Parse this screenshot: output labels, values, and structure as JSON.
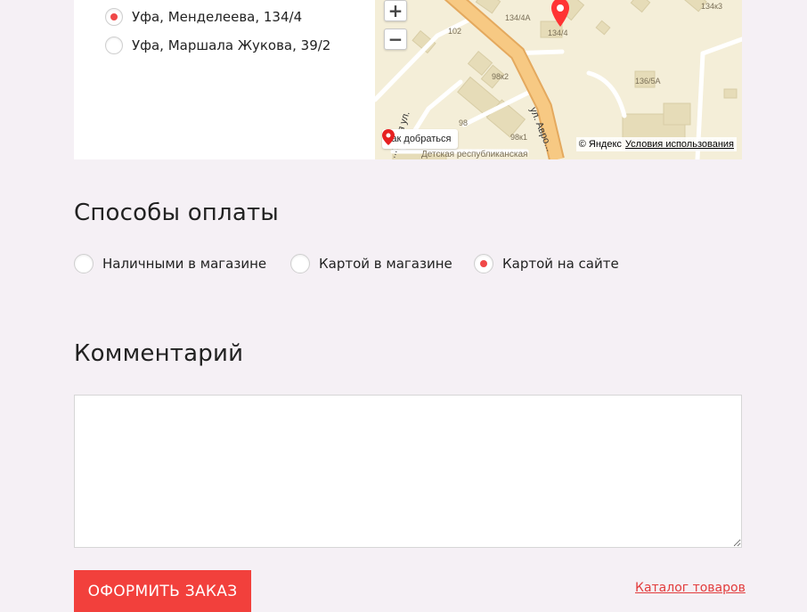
{
  "stores": {
    "options": [
      {
        "label": "Уфа, Менделеева, 134/4",
        "checked": true
      },
      {
        "label": "Уфа, Маршала Жукова, 39/2",
        "checked": false
      }
    ]
  },
  "map": {
    "zoom_in": "+",
    "zoom_out": "−",
    "route_label": "Как добраться",
    "copyright": "© Яндекс",
    "terms_link": "Условия использования",
    "labels": {
      "b102": "102",
      "b134_4a": "134/4A",
      "b134_4": "134/4",
      "b134k3": "134к3",
      "b98k2": "98к2",
      "b136_5a": "136/5А",
      "b98": "98",
      "b98k1": "98к1",
      "street_sovetskaya": "...тская ул.",
      "street_avrory": "ул. Авро...",
      "street_detskaya": "Детская республиканская"
    }
  },
  "payment": {
    "title": "Способы оплаты",
    "options": [
      {
        "label": "Наличными в магазине",
        "checked": false
      },
      {
        "label": "Картой в магазине",
        "checked": false
      },
      {
        "label": "Картой на сайте",
        "checked": true
      }
    ]
  },
  "comment": {
    "title": "Комментарий",
    "value": ""
  },
  "actions": {
    "submit_label": "ОФОРМИТЬ ЗАКАЗ",
    "catalog_link": "Каталог товаров"
  },
  "colors": {
    "accent": "#f2403c",
    "background": "#f5f0f5",
    "map_ground": "#f4eed8",
    "map_road": "#f6c57a",
    "map_building": "#e6dcb8"
  }
}
